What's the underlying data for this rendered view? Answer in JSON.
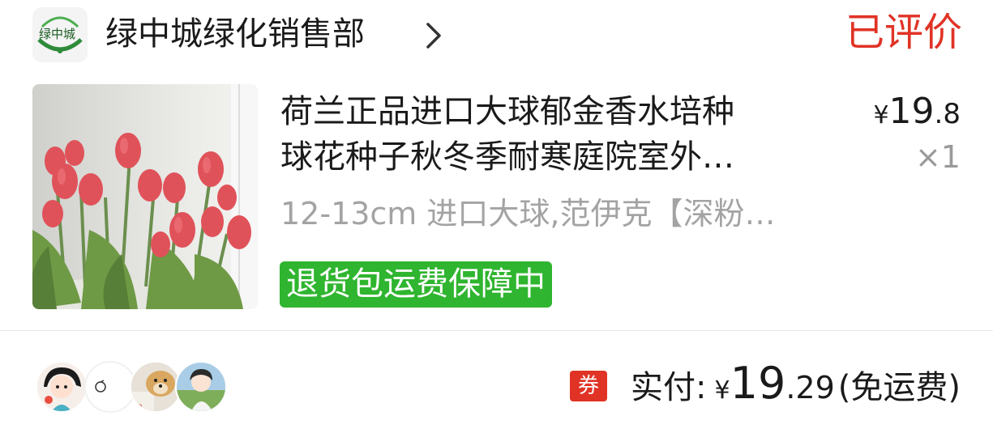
{
  "shop": {
    "logo_text": "绿中城",
    "name": "绿中城绿化销售部",
    "icons": {
      "logo": "shop-logo",
      "chevron": "chevron-right-icon"
    }
  },
  "order": {
    "status": "已评价"
  },
  "product": {
    "title_line1": "荷兰正品进口大球郁金香水培种",
    "title_line2": "球花种子秋冬季耐寒庭院室外…",
    "spec": "12-13cm 进口大球,范伊克【深粉…",
    "price": {
      "symbol": "¥",
      "integer": "19",
      "decimal": ".8"
    },
    "quantity": "×1",
    "guarantee_badge": "退货包运费保障中",
    "colors": {
      "badge_bg": "#2fb52f",
      "status": "#e03326"
    }
  },
  "footer": {
    "coupon_label": "券",
    "paid_label": "实付:",
    "paid": {
      "symbol": "¥",
      "integer": "19",
      "decimal": ".29"
    },
    "shipping_note": "(免运费)",
    "avatars": [
      "avatar-cartoon-girl",
      "avatar-white-doodle",
      "avatar-dog",
      "avatar-anime-girl"
    ]
  }
}
